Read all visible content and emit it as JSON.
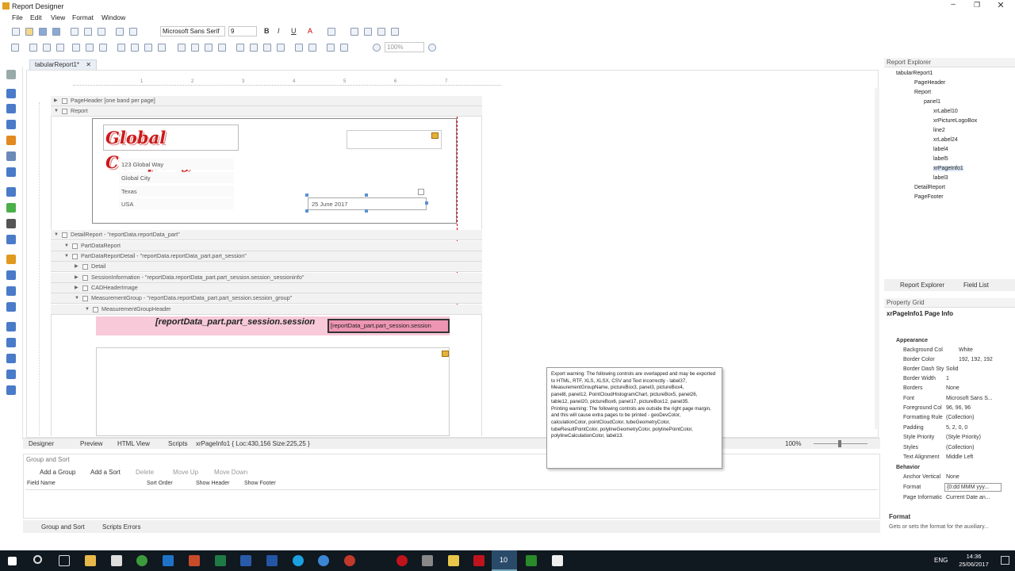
{
  "window": {
    "title": "Report Designer"
  },
  "menu": [
    "File",
    "Edit",
    "View",
    "Format",
    "Window"
  ],
  "toolbar": {
    "font": "Microsoft Sans Serif",
    "size": "9",
    "zoom": "100%"
  },
  "tab": {
    "label": "tabularReport1*"
  },
  "ruler": [
    "1",
    "2",
    "3",
    "4",
    "5",
    "6",
    "7"
  ],
  "bands": {
    "page_header": "PageHeader [one band per page]",
    "report": "Report",
    "detail_report": "DetailReport - \"reportData.reportData_part\"",
    "part_data_report": "PartDataReport",
    "part_data_report_detail": "PartDataReportDetail - \"reportData.reportData_part.part_session\"",
    "detail": "Detail",
    "session_info": "SessionInformation - \"reportData.reportData_part.part_session.session_sessioninfo\"",
    "cad_header": "CADHeaderImage",
    "measurement_group": "MeasurementGroup - \"reportData.reportData_part.part_session.session_group\"",
    "measurement_group_header": "MeasurementGroupHeader"
  },
  "report": {
    "logo": "Global Company",
    "address": [
      "123 Global Way",
      "Global City",
      "Texas",
      "USA"
    ],
    "date": "25 June 2017",
    "session_label": "[reportData_part.part_session.session",
    "session_field": "[reportData_part.part_session.session"
  },
  "status": {
    "tabs": [
      "Designer",
      "Preview",
      "HTML View",
      "Scripts"
    ],
    "info": "xrPageInfo1 { Loc:430,156 Size:225,25 }",
    "zoom": "100%"
  },
  "group_sort": {
    "title": "Group and Sort",
    "actions": [
      "Add a Group",
      "Add a Sort",
      "Delete",
      "Move Up",
      "Move Down"
    ],
    "columns": [
      "Field Name",
      "Sort Order",
      "Show Header",
      "Show Footer"
    ],
    "bottom_tabs": [
      "Group and Sort",
      "Scripts Errors"
    ]
  },
  "explorer": {
    "title": "Report Explorer",
    "items": [
      "tabularReport1",
      "PageHeader",
      "Report",
      "panel1",
      "xrLabel10",
      "xrPictureLogoBox",
      "line2",
      "xrLabel24",
      "label4",
      "label5",
      "xrPageInfo1",
      "label3",
      "DetailReport",
      "PageFooter"
    ],
    "tabs": [
      "Report Explorer",
      "Field List"
    ]
  },
  "property_grid": {
    "title": "Property Grid",
    "selected": "xrPageInfo1  Page Info",
    "cat_appearance": "Appearance",
    "cat_behavior": "Behavior",
    "props": [
      {
        "name": "Background Col",
        "value": "White"
      },
      {
        "name": "Border Color",
        "value": "192, 192, 192"
      },
      {
        "name": "Border Dash Sty",
        "value": "Solid"
      },
      {
        "name": "Border Width",
        "value": "1"
      },
      {
        "name": "Borders",
        "value": "None"
      },
      {
        "name": "Font",
        "value": "Microsoft Sans S..."
      },
      {
        "name": "Foreground Col",
        "value": "96, 96, 96"
      },
      {
        "name": "Formatting Rule",
        "value": "(Collection)"
      },
      {
        "name": "Padding",
        "value": "5, 2, 0, 0"
      },
      {
        "name": "Style Priority",
        "value": "(Style Priority)"
      },
      {
        "name": "Styles",
        "value": "(Collection)"
      },
      {
        "name": "Text Alignment",
        "value": "Middle Left"
      }
    ],
    "behavior_props": [
      {
        "name": "Anchor Vertical",
        "value": "None"
      },
      {
        "name": "Format",
        "value": "{0:dd MMM yyy..."
      },
      {
        "name": "Page Informatic",
        "value": "Current Date an..."
      }
    ],
    "desc_title": "Format",
    "desc_text": "Gets or sets the format for the auxiliary..."
  },
  "toast": {
    "text": "Export warning: The following controls are overlapped and may be exported to HTML, RTF, XLS, XLSX, CSV and Text incorrectly - label37, MeasurementGroupName, pictureBox3, panel3, pictureBox4,\npanel8, panel12, PointCloudHistogramChart, pictureBox5, panel26,\ntable12, panel20, pictureBox6, panel17, pictureBox12, panel35.\nPrinting warning: The following controls are outside the right page margin, and this will cause extra pages to be printed - geoDevColor, calculationColor, pointCloudColor, tubeGeometryColor, tubeResultPointColor, polylineGeometryColor, polylinePointColor, polylineCalculationColor, label13."
  },
  "taskbar": {
    "lang": "ENG",
    "time": "14:36",
    "date": "25/06/2017",
    "active_badge": "10"
  }
}
